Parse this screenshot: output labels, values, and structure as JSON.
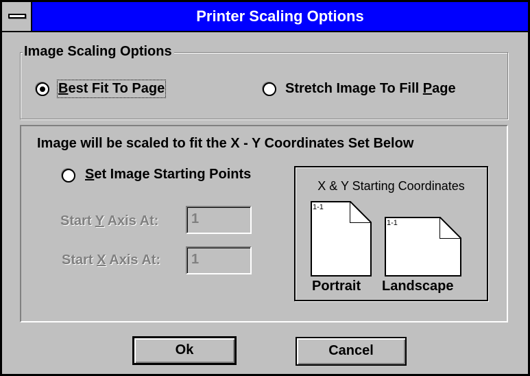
{
  "window": {
    "title": "Printer Scaling Options"
  },
  "group": {
    "legend": "Image Scaling Options",
    "best_fit_pre": "",
    "best_fit_u": "B",
    "best_fit_post": "est Fit To Page",
    "stretch_pre": "Stretch Image To Fill ",
    "stretch_u": "P",
    "stretch_post": "age",
    "selected": "best_fit"
  },
  "coords": {
    "heading": "Image will be scaled to fit the X - Y Coordinates Set Below",
    "set_points_u": "S",
    "set_points_post": "et Image Starting Points",
    "start_y_pre": "Start ",
    "start_y_u": "Y",
    "start_y_post": " Axis At:",
    "start_x_pre": "Start ",
    "start_x_u": "X",
    "start_x_post": " Axis At:",
    "start_y_value": "1",
    "start_x_value": "1"
  },
  "preview": {
    "title": "X & Y Starting Coordinates",
    "portrait_label": "Portrait",
    "landscape_label": "Landscape",
    "portrait_origin": "1-1",
    "landscape_origin": "1-1"
  },
  "buttons": {
    "ok": "Ok",
    "cancel": "Cancel"
  }
}
